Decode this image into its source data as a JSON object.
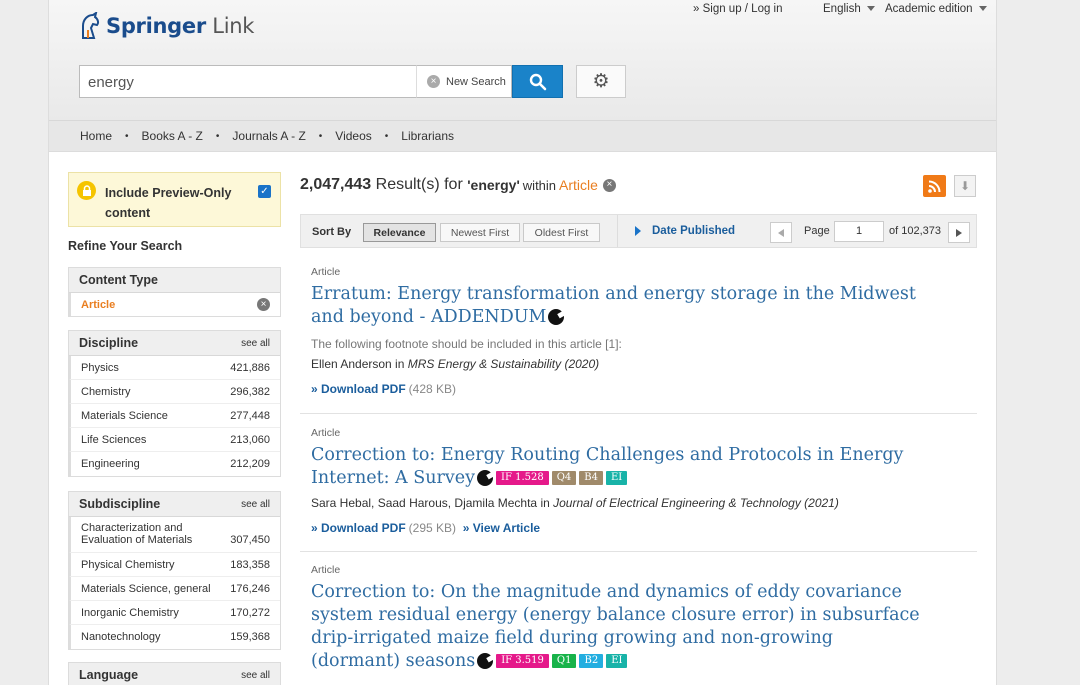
{
  "header": {
    "logo_text_bold": "Springer",
    "logo_text_light": "Link",
    "signup_login": "» Sign up / Log in",
    "language": "English",
    "edition": "Academic edition"
  },
  "search": {
    "query": "energy",
    "new_search_label": "New Search"
  },
  "nav": {
    "items": [
      "Home",
      "Books A - Z",
      "Journals A - Z",
      "Videos",
      "Librarians"
    ],
    "separator": "•"
  },
  "sidebar": {
    "preview_label": "Include Preview-Only content",
    "refine_title": "Refine Your Search",
    "content_type": {
      "title": "Content Type",
      "selected": "Article"
    },
    "discipline": {
      "title": "Discipline",
      "see_all": "see all",
      "items": [
        {
          "label": "Physics",
          "count": "421,886"
        },
        {
          "label": "Chemistry",
          "count": "296,382"
        },
        {
          "label": "Materials Science",
          "count": "277,448"
        },
        {
          "label": "Life Sciences",
          "count": "213,060"
        },
        {
          "label": "Engineering",
          "count": "212,209"
        }
      ]
    },
    "subdiscipline": {
      "title": "Subdiscipline",
      "see_all": "see all",
      "items": [
        {
          "label": "Characterization and Evaluation of Materials",
          "count": "307,450"
        },
        {
          "label": "Physical Chemistry",
          "count": "183,358"
        },
        {
          "label": "Materials Science, general",
          "count": "176,246"
        },
        {
          "label": "Inorganic Chemistry",
          "count": "170,272"
        },
        {
          "label": "Nanotechnology",
          "count": "159,368"
        }
      ]
    },
    "language": {
      "title": "Language",
      "see_all": "see all"
    }
  },
  "results": {
    "count": "2,047,443",
    "label": "Result(s) for",
    "query": "'energy'",
    "within": "within",
    "filter": "Article"
  },
  "sort": {
    "label": "Sort By",
    "options": [
      "Relevance",
      "Newest First",
      "Oldest First"
    ],
    "active": "Relevance",
    "date_published": "Date Published",
    "page_label": "Page",
    "page_value": "1",
    "page_total": "of 102,373"
  },
  "items": [
    {
      "type": "Article",
      "title": "Erratum: Energy transformation and energy storage in the Midwest and beyond - ADDENDUM",
      "snippet": "The following footnote should be included in this article [1]:",
      "authors": "Ellen Anderson in ",
      "journal": "MRS Energy & Sustainability (2020)",
      "download": "» Download PDF",
      "size": "(428 KB)"
    },
    {
      "type": "Article",
      "title": "Correction to: Energy Routing Challenges and Protocols in Energy Internet: A Survey",
      "badges": [
        {
          "text": "IF 1.528",
          "color": "#e5198a"
        },
        {
          "text": "Q4",
          "color": "#a08a6a"
        },
        {
          "text": "B4",
          "color": "#a08a6a"
        },
        {
          "text": "EI",
          "color": "#18b3a8"
        }
      ],
      "authors": "Sara Hebal, Saad Harous, Djamila Mechta in ",
      "journal": "Journal of Electrical Engineering & Technology (2021)",
      "download": "» Download PDF",
      "size": "(295 KB)",
      "view": "» View Article"
    },
    {
      "type": "Article",
      "title": "Correction to: On the magnitude and dynamics of eddy covariance system residual energy (energy balance closure error) in subsurface drip-irrigated maize field during growing and non-growing (dormant) seasons",
      "badges": [
        {
          "text": "IF 3.519",
          "color": "#e5198a"
        },
        {
          "text": "Q1",
          "color": "#18b34a"
        },
        {
          "text": "B2",
          "color": "#23aee0"
        },
        {
          "text": "EI",
          "color": "#18b3a8"
        }
      ]
    }
  ]
}
